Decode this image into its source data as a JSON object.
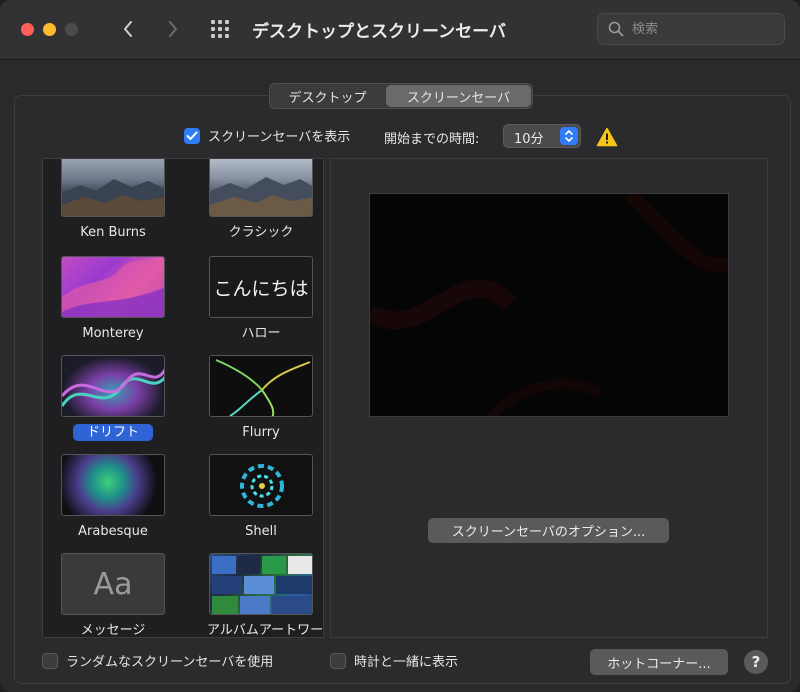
{
  "window": {
    "title": "デスクトップとスクリーンセーバ",
    "search_placeholder": "検索"
  },
  "tabs": [
    {
      "label": "デスクトップ",
      "selected": false
    },
    {
      "label": "スクリーンセーバ",
      "selected": true
    }
  ],
  "options": {
    "show_screensaver_label": "スクリーンセーバを表示",
    "show_screensaver_checked": true,
    "start_after_label": "開始までの時間:",
    "start_after_value": "10分"
  },
  "savers": [
    {
      "name": "Ken Burns",
      "selected": false
    },
    {
      "name": "クラシック",
      "selected": false
    },
    {
      "name": "Monterey",
      "selected": false
    },
    {
      "name": "ハロー",
      "selected": false,
      "thumb_text": "こんにちは"
    },
    {
      "name": "ドリフト",
      "selected": true
    },
    {
      "name": "Flurry",
      "selected": false
    },
    {
      "name": "Arabesque",
      "selected": false
    },
    {
      "name": "Shell",
      "selected": false
    },
    {
      "name": "メッセージ",
      "selected": false,
      "thumb_text": "Aa"
    },
    {
      "name": "アルバムアートワーク",
      "selected": false
    }
  ],
  "preview": {
    "options_button": "スクリーンセーバのオプション..."
  },
  "footer": {
    "random_label": "ランダムなスクリーンセーバを使用",
    "random_checked": false,
    "clock_label": "時計と一緒に表示",
    "clock_checked": false,
    "hot_corners_button": "ホットコーナー...",
    "help_button": "?"
  },
  "colors": {
    "accent": "#2f7cf6",
    "selection": "#2f64d6",
    "warning": "#f5c518"
  }
}
